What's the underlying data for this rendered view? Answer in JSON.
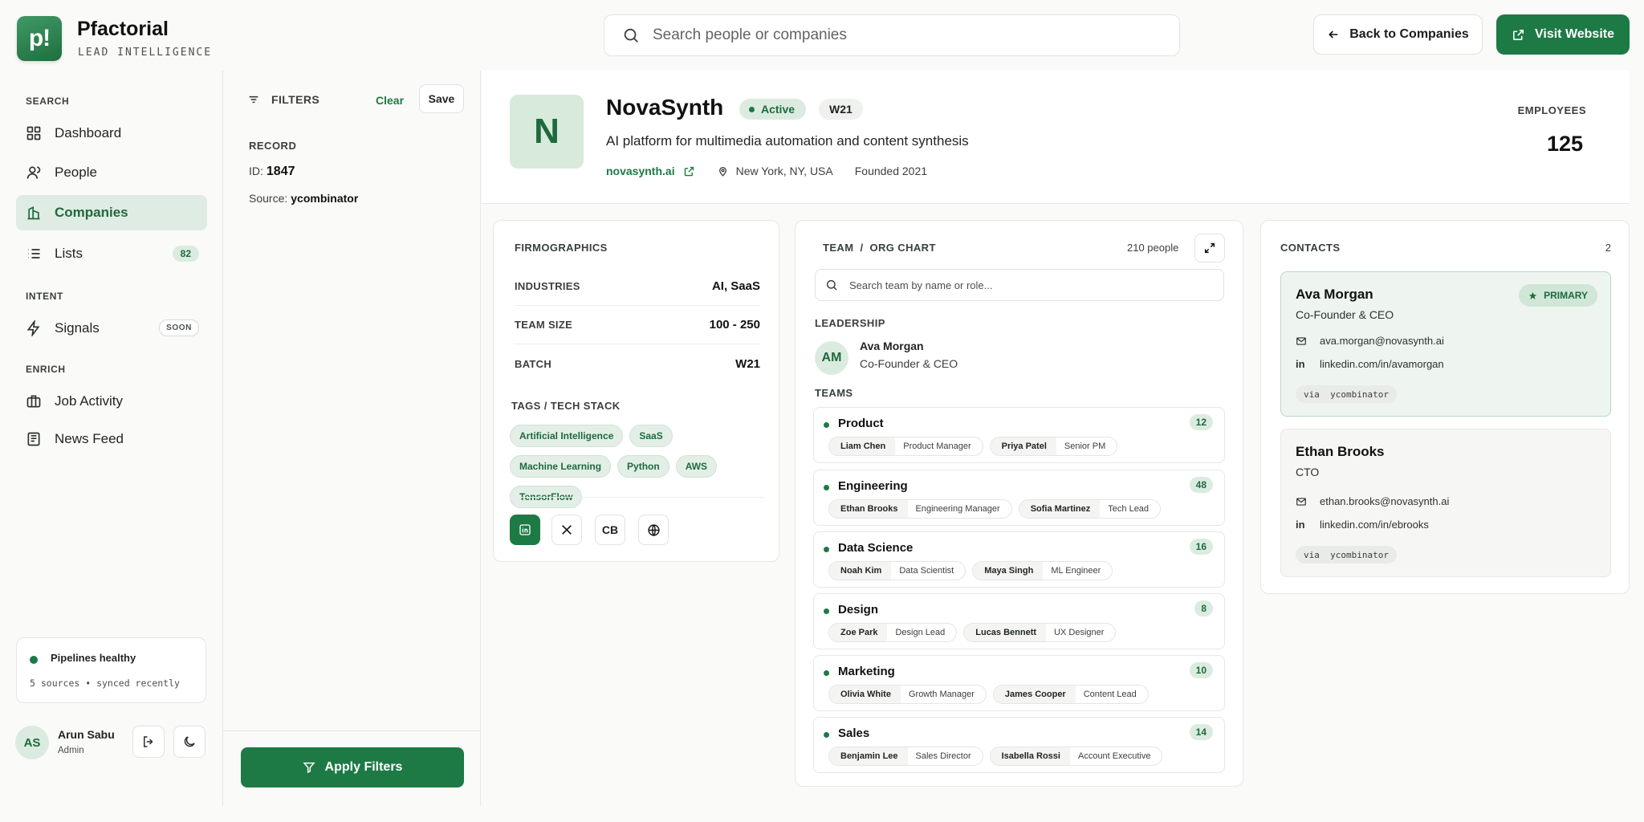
{
  "brand": {
    "initials": "p!",
    "name": "Pfactorial",
    "subtitle": "LEAD INTELLIGENCE"
  },
  "search": {
    "placeholder": "Search people or companies"
  },
  "actions": {
    "back_label": "Back to Companies",
    "visit_label": "Visit Website"
  },
  "sidebar": {
    "sections": {
      "search": "SEARCH",
      "intent": "INTENT",
      "enrich": "ENRICH"
    },
    "items": [
      {
        "label": "Dashboard",
        "icon": "dashboard-icon"
      },
      {
        "label": "People",
        "icon": "person-icon"
      },
      {
        "label": "Companies",
        "icon": "building-icon",
        "active": true
      },
      {
        "label": "Lists",
        "icon": "list-icon",
        "badge": "82"
      },
      {
        "label": "Signals",
        "icon": "bolt-icon",
        "badge": "SOON"
      },
      {
        "label": "Job Activity",
        "icon": "briefcase-icon"
      },
      {
        "label": "News Feed",
        "icon": "newspaper-icon"
      }
    ],
    "pipeline": {
      "title": "Pipelines healthy",
      "detail": "5 sources • synced recently"
    },
    "user": {
      "initials": "AS",
      "name": "Arun Sabu",
      "role": "Admin"
    }
  },
  "filters": {
    "title": "FILTERS",
    "clear_label": "Clear",
    "save_label": "Save",
    "record_label": "RECORD",
    "id_label": "ID:",
    "id_value": "1847",
    "source_label": "Source:",
    "source_value": "ycombinator",
    "apply_label": "Apply Filters"
  },
  "company": {
    "initial": "N",
    "name": "NovaSynth",
    "status": "Active",
    "batch": "W21",
    "tagline": "AI platform for multimedia automation and content synthesis",
    "website": "novasynth.ai",
    "location": "New York, NY, USA",
    "founded": "Founded 2021",
    "employees_label": "EMPLOYEES",
    "employees": "125"
  },
  "firmographics": {
    "title": "FIRMOGRAPHICS",
    "rows": [
      {
        "key": "INDUSTRIES",
        "value": "AI, SaaS"
      },
      {
        "key": "TEAM SIZE",
        "value": "100 - 250"
      },
      {
        "key": "BATCH",
        "value": "W21"
      }
    ],
    "tags_title": "TAGS / TECH STACK",
    "tags": [
      "Artificial Intelligence",
      "SaaS",
      "Machine Learning",
      "Python",
      "AWS",
      "TensorFlow"
    ],
    "social": {
      "crunchbase": "CB"
    }
  },
  "team": {
    "title": "TEAM  /  ORG CHART",
    "count": "210 people",
    "search_placeholder": "Search team by name or role...",
    "leadership_label": "LEADERSHIP",
    "leader": {
      "initials": "AM",
      "name": "Ava Morgan",
      "title": "Co-Founder & CEO"
    },
    "teams_label": "TEAMS",
    "teams": [
      {
        "name": "Product",
        "count": "12",
        "members": [
          {
            "name": "Liam Chen",
            "role": "Product Manager"
          },
          {
            "name": "Priya Patel",
            "role": "Senior PM"
          }
        ]
      },
      {
        "name": "Engineering",
        "count": "48",
        "members": [
          {
            "name": "Ethan Brooks",
            "role": "Engineering Manager"
          },
          {
            "name": "Sofia Martinez",
            "role": "Tech Lead"
          }
        ]
      },
      {
        "name": "Data Science",
        "count": "16",
        "members": [
          {
            "name": "Noah Kim",
            "role": "Data Scientist"
          },
          {
            "name": "Maya Singh",
            "role": "ML Engineer"
          }
        ]
      },
      {
        "name": "Design",
        "count": "8",
        "members": [
          {
            "name": "Zoe Park",
            "role": "Design Lead"
          },
          {
            "name": "Lucas Bennett",
            "role": "UX Designer"
          }
        ]
      },
      {
        "name": "Marketing",
        "count": "10",
        "members": [
          {
            "name": "Olivia White",
            "role": "Growth Manager"
          },
          {
            "name": "James Cooper",
            "role": "Content Lead"
          }
        ]
      },
      {
        "name": "Sales",
        "count": "14",
        "members": [
          {
            "name": "Benjamin Lee",
            "role": "Sales Director"
          },
          {
            "name": "Isabella Rossi",
            "role": "Account Executive"
          }
        ]
      }
    ]
  },
  "contacts": {
    "title": "CONTACTS",
    "count": "2",
    "primary_label": "PRIMARY",
    "list": [
      {
        "name": "Ava Morgan",
        "title": "Co-Founder & CEO",
        "email": "ava.morgan@novasynth.ai",
        "linkedin": "linkedin.com/in/avamorgan",
        "via": "via  ycombinator"
      },
      {
        "name": "Ethan Brooks",
        "title": "CTO",
        "email": "ethan.brooks@novasynth.ai",
        "linkedin": "linkedin.com/in/ebrooks",
        "via": "via  ycombinator"
      }
    ]
  },
  "colors": {
    "accent": "#1d7a45",
    "accent_soft": "#dcebdf",
    "background": "#fafaf8"
  }
}
